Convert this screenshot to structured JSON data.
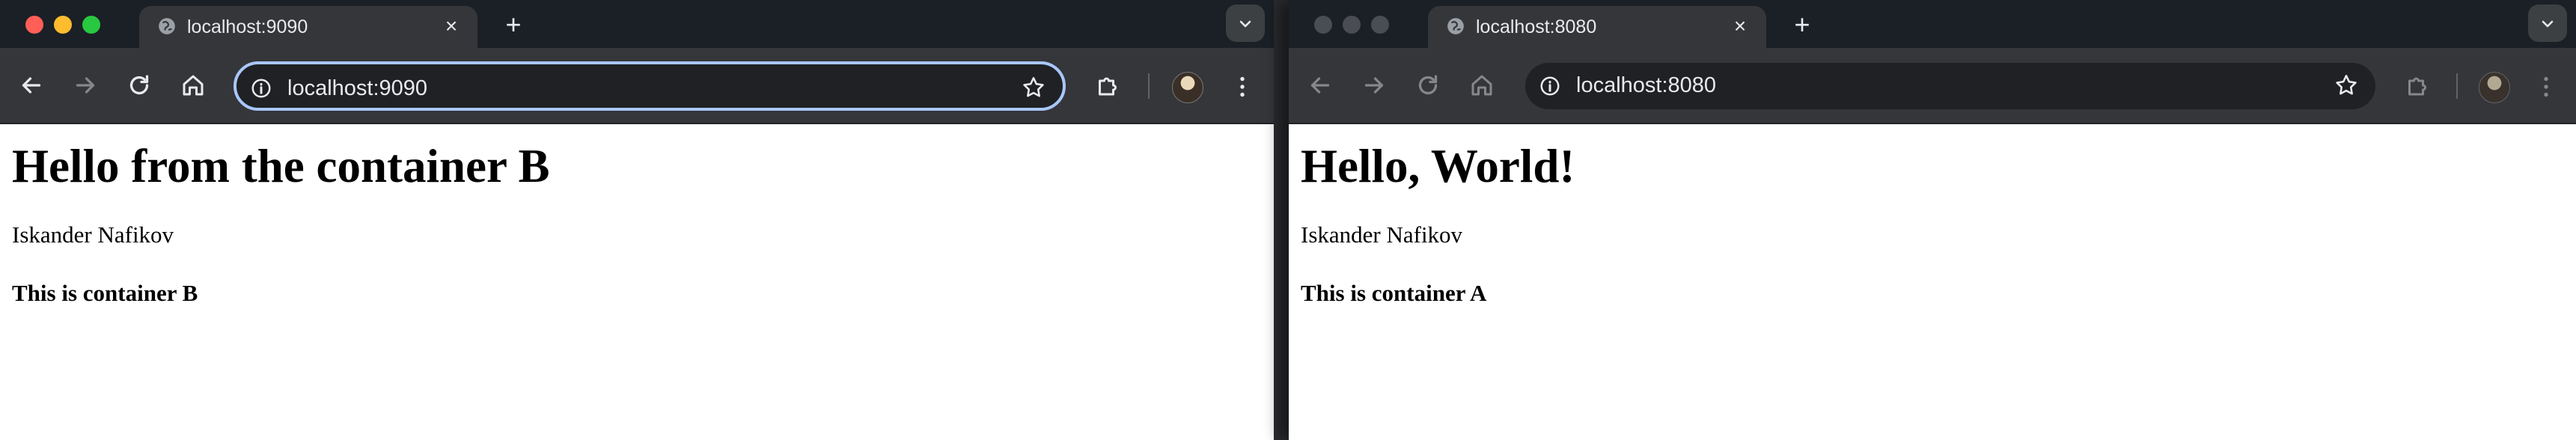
{
  "windows": [
    {
      "id": "left",
      "active": true,
      "tab": {
        "title": "localhost:9090"
      },
      "address_bar": {
        "url": "localhost:9090"
      },
      "page": {
        "heading": "Hello from the container B",
        "author": "Iskander Nafikov",
        "subtitle": "This is container B"
      }
    },
    {
      "id": "right",
      "active": false,
      "tab": {
        "title": "localhost:8080"
      },
      "address_bar": {
        "url": "localhost:8080"
      },
      "page": {
        "heading": "Hello, World!",
        "author": "Iskander Nafikov",
        "subtitle": "This is container A"
      }
    }
  ],
  "theme": {
    "close_color": "#ff5f57",
    "minimize_color": "#febc2e",
    "zoom_color": "#28c840",
    "inactive_light_color": "#4a4d52",
    "focus_ring_color": "#a8c7fa"
  },
  "icons": {
    "tab_favicon": "globe-icon",
    "back": "arrow-left-icon",
    "forward": "arrow-right-icon",
    "reload": "reload-icon",
    "home": "home-icon",
    "site_info": "info-icon",
    "bookmark": "star-icon",
    "extensions": "puzzle-icon",
    "menu": "kebab-icon",
    "tab_search": "chevron-down-icon"
  }
}
